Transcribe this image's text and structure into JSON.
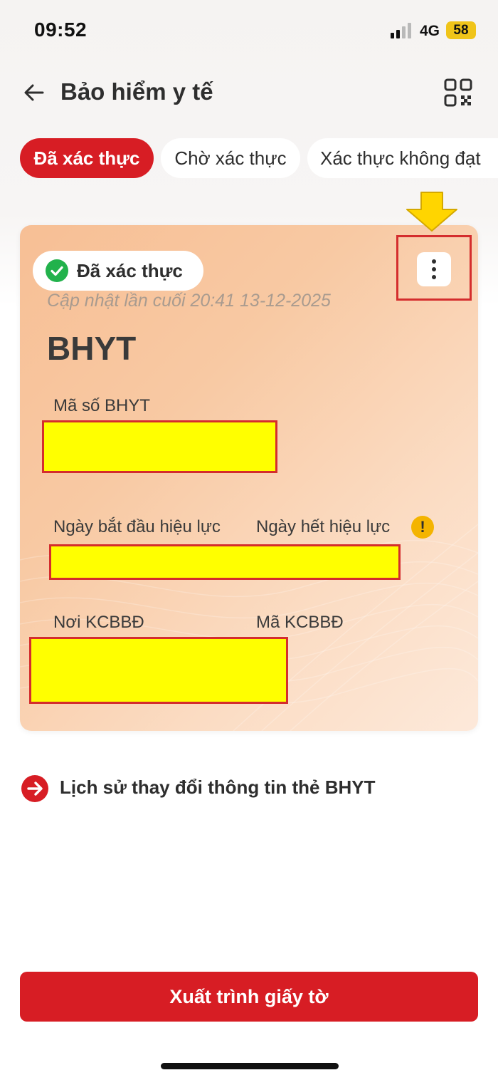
{
  "status_bar": {
    "time": "09:52",
    "network": "4G",
    "battery": "58"
  },
  "header": {
    "title": "Bảo hiểm y tế",
    "back_icon": "arrow-left-icon",
    "qr_icon": "qr-code-icon"
  },
  "tabs": [
    {
      "label": "Đã xác thực",
      "active": true
    },
    {
      "label": "Chờ xác thực",
      "active": false
    },
    {
      "label": "Xác thực không đạt",
      "active": false
    }
  ],
  "card": {
    "status_badge": "Đã xác thực",
    "last_updated": "Cập nhật lần cuối 20:41 13-12-2025",
    "title": "BHYT",
    "fields": {
      "card_number_label": "Mã số BHYT",
      "start_date_label": "Ngày bắt đầu hiệu lực",
      "end_date_label": "Ngày hết hiệu lực",
      "warning_glyph": "!",
      "facility_label": "Nơi KCBBĐ",
      "facility_code_label": "Mã KCBBĐ"
    }
  },
  "history_link": {
    "label": "Lịch sử thay đổi thông tin thẻ BHYT"
  },
  "submit_button": {
    "label": "Xuất trình giấy tờ"
  },
  "colors": {
    "brand_red": "#d71d24",
    "card_bg": "#f8c9a3",
    "success_green": "#22b24c",
    "warning_yellow": "#f4b400",
    "redaction_yellow": "#ffff00"
  }
}
